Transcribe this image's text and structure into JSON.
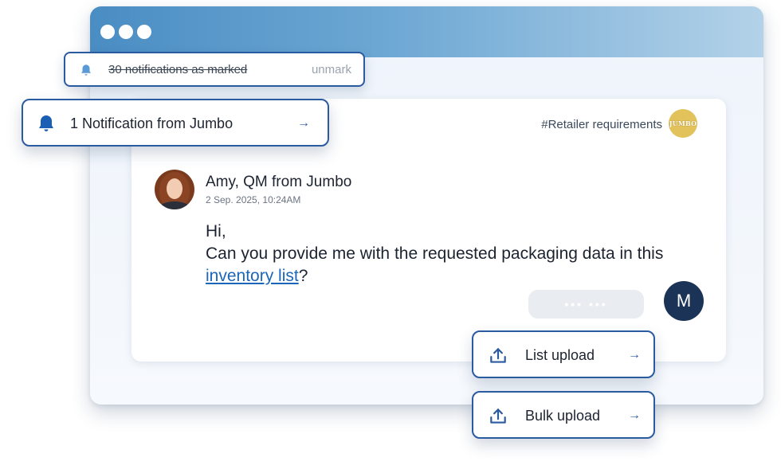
{
  "notifications": {
    "marked_text": "30 notifications as marked",
    "unmark_label": "unmark",
    "new_text": "1 Notification from Jumbo",
    "arrow": "→"
  },
  "channel": {
    "tag": "#Retailer requirements",
    "logo_text": "JUMBO",
    "logo_color": "#e2c25a"
  },
  "message": {
    "sender": "Amy, QM from Jumbo",
    "timestamp": "2 Sep. 2025, 10:24AM",
    "greeting": "Hi,",
    "body_before_link": "Can you provide me with the requested packaging data in this ",
    "link_text": "inventory list",
    "body_after_link": "?"
  },
  "reply": {
    "typing_indicator": "••• •••",
    "user_initial": "M"
  },
  "actions": {
    "list_upload": "List upload",
    "bulk_upload": "Bulk upload",
    "arrow": "→"
  },
  "colors": {
    "accent": "#2a5aa0",
    "link": "#1a66b8",
    "user_avatar": "#1c3358"
  }
}
